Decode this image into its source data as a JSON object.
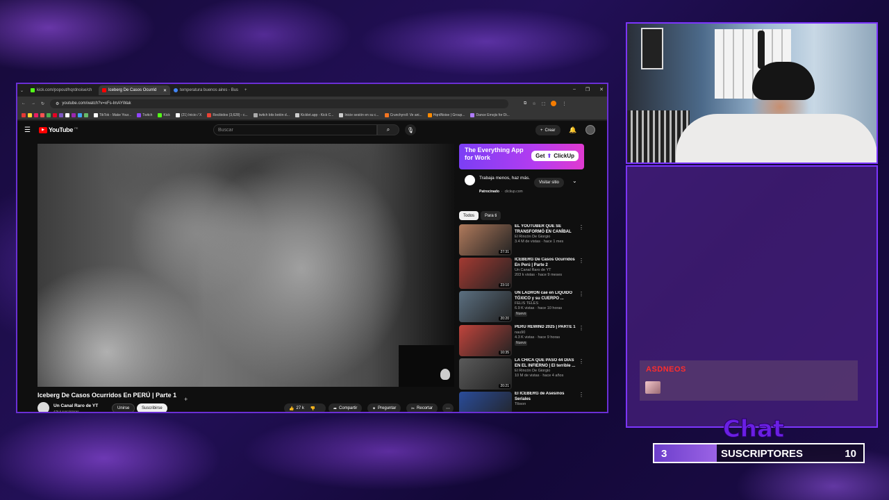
{
  "browser": {
    "tabs": [
      {
        "label": "kick.com/popout/hqrdnoise/ch",
        "color": "#53fc18",
        "active": false
      },
      {
        "label": "Iceberg De Casos Ocurrid",
        "color": "#ff0000",
        "active": true
      },
      {
        "label": "temperatura buenos aires - Bus",
        "color": "#4285f4",
        "active": false
      }
    ],
    "new_tab": "+",
    "url": "youtube.com/watch?v=xFs-ImAYWak",
    "bookmarks": [
      {
        "label": "TikTok - Make Your...",
        "color": "#ffffff"
      },
      {
        "label": "Twitch",
        "color": "#9146ff"
      },
      {
        "label": "Kick",
        "color": "#53fc18"
      },
      {
        "label": "(21) Inicio / X",
        "color": "#ffffff"
      },
      {
        "label": "Recibidos (3,628) - c...",
        "color": "#ea4335"
      },
      {
        "label": "twitch bits botón d...",
        "color": "#aaaaaa"
      },
      {
        "label": "Kicklet.app - Kick C...",
        "color": "#cccccc"
      },
      {
        "label": "Inicie sesión en su c...",
        "color": "#cccccc"
      },
      {
        "label": "Crunchyroll: Ve ani...",
        "color": "#f47521"
      },
      {
        "label": "HqrdNoise | Group...",
        "color": "#ff8a00"
      },
      {
        "label": "Dance Emojis for Di...",
        "color": "#b07cff"
      }
    ]
  },
  "youtube": {
    "logo": "YouTube",
    "region": "PE",
    "search_placeholder": "Buscar",
    "create_label": "Crear",
    "video_title": "Iceberg De Casos Ocurridos En PERÚ | Parte 1",
    "channel": "Un Canal Raro de YT",
    "subscribers": "476 k suscriptores",
    "join": "Unirse",
    "subscribe": "Suscribirse",
    "likes": "27 k",
    "share": "Compartir",
    "ask": "Preguntar",
    "clip": "Recortar",
    "ad": {
      "headline": "The Everything App for Work",
      "cta": "Get",
      "brand": "ClickUp",
      "text": "Trabaja menos, haz más.",
      "sponsored": "Patrocinado",
      "domain": "clickup.com",
      "visit": "Visitar sitio"
    },
    "chips": [
      "Todos",
      "Para ti"
    ],
    "recommendations": [
      {
        "title": "EL YOUTUBER QUE SE TRANSFORMÓ EN CANÍBAL ...",
        "channel": "El Rincón De Giorgio",
        "meta": "3.4 M de vistas · hace 1 mes",
        "duration": "27:31",
        "new": "",
        "thumb": "#b07a5c"
      },
      {
        "title": "ICEBERG De Casos Ocurridos En Perú | Parte 2",
        "channel": "Un Canal Raro de YT",
        "meta": "203 k vistas · hace 9 meses",
        "duration": "23:10",
        "new": "",
        "thumb": "#a33a32"
      },
      {
        "title": "UN LADRÓN cae en LÍQUIDO TÓXICO y su CUERPO ...",
        "channel": "FELIS TELES",
        "meta": "6.9 K vistas · hace 10 horas",
        "duration": "20:20",
        "new": "Nuevo",
        "thumb": "#5b6f80"
      },
      {
        "title": "PERU REWIND 2025 | PARTE 1",
        "channel": "nau90",
        "meta": "4.3 K vistas · hace 9 horas",
        "duration": "10:35",
        "new": "Nuevo",
        "thumb": "#c0443c"
      },
      {
        "title": "LA CHICA QUE PASÓ 44 DÍAS EN EL INFIERNO | El terrible ...",
        "channel": "El Rincón De Giorgio",
        "meta": "10 M de vistas · hace 4 años",
        "duration": "20:21",
        "new": "",
        "thumb": "#5a5a5a"
      },
      {
        "title": "El ICEBERG de Asesinos Seriales",
        "channel": "Tibson",
        "meta": "",
        "duration": "",
        "new": "",
        "thumb": "#2a4c9a"
      }
    ]
  },
  "overlay": {
    "chat_title": "Chat",
    "chat_user": "ASDNEOS",
    "subs_current": "3",
    "subs_label": "SUSCRIPTORES",
    "subs_goal": "10",
    "subs_progress": 0.3
  }
}
